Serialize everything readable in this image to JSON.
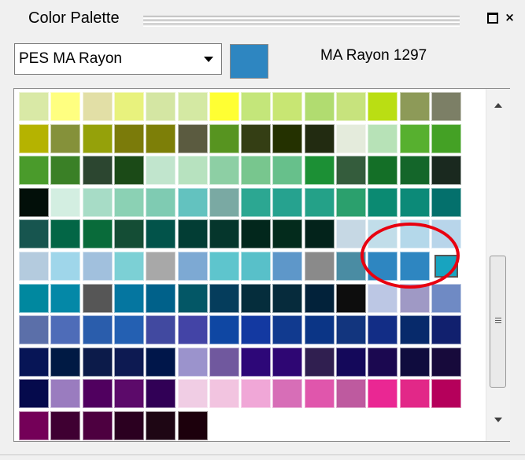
{
  "panel": {
    "title": "Color Palette",
    "restore_icon": "restore-icon",
    "close_icon": "close-icon",
    "close_glyph": "×"
  },
  "thread_selector": {
    "value": "PES MA Rayon",
    "arrow_icon": "dropdown-arrow-icon"
  },
  "current_color": {
    "name": "MA Rayon 1297",
    "hex": "#2e86c1"
  },
  "palette": {
    "columns": 15,
    "selected_index": 83,
    "colors": [
      "#d9e9a6",
      "#ffff80",
      "#e2dfa6",
      "#e8f27d",
      "#d4e6a3",
      "#d4e9a3",
      "#ffff33",
      "#c4e67a",
      "#c8e673",
      "#b1dc70",
      "#c7e37d",
      "#bade13",
      "#8d9a58",
      "#7c7f66",
      "#b5b300",
      "#85913a",
      "#95a10a",
      "#7b7b0a",
      "#7d7f08",
      "#5b5b40",
      "#579420",
      "#343e14",
      "#243100",
      "#222b11",
      "#e4ebdc",
      "#b7e2b7",
      "#57b02f",
      "#44a125",
      "#4a9b2b",
      "#3a8026",
      "#2c4630",
      "#1b4a17",
      "#c1e5cd",
      "#b7e2bf",
      "#8dcfa4",
      "#78c68e",
      "#67c08b",
      "#1c9035",
      "#345c3c",
      "#146f27",
      "#14662a",
      "#1a291f",
      "#020f09",
      "#d3eee1",
      "#a7dcc6",
      "#8bd1b4",
      "#7fcbb2",
      "#63c2bf",
      "#7aa9a3",
      "#2ca792",
      "#26a28f",
      "#24a188",
      "#2ba06d",
      "#0b8a72",
      "#0c8a78",
      "#04706c",
      "#17554f",
      "#036646",
      "#096b3a",
      "#144d35",
      "#02534a",
      "#023d34",
      "#05362c",
      "#02271c",
      "#032b1c",
      "#03231b",
      "#c6d8e4",
      "#c1dde9",
      "#b4d8ea",
      "#b8d5ea",
      "#b4cbde",
      "#9fd6ea",
      "#a1c0dd",
      "#7cd0d5",
      "#a8a8a8",
      "#7da9d3",
      "#5ec5cd",
      "#58c0c9",
      "#5e97c9",
      "#8a8a8a",
      "#4a8ca3",
      "#2e86c1",
      "#2e86c1",
      "#18a4c0",
      "#00889f",
      "#0488a7",
      "#565656",
      "#0576a0",
      "#00618a",
      "#035766",
      "#053d5c",
      "#052d3c",
      "#062b3c",
      "#02223a",
      "#0d0d0d",
      "#bcc7e4",
      "#9f99c5",
      "#6f8ac4",
      "#5b6fa9",
      "#4e6cb8",
      "#2a5dac",
      "#2460b2",
      "#4149a0",
      "#4344a6",
      "#0f47a3",
      "#1339a1",
      "#113a8f",
      "#0b3586",
      "#12357e",
      "#122d86",
      "#072a6b",
      "#11206e",
      "#071556",
      "#001a44",
      "#0c1b4a",
      "#0d1a52",
      "#00164a",
      "#9b93cc",
      "#70589e",
      "#2d0778",
      "#2e0673",
      "#301f50",
      "#14085a",
      "#1b0850",
      "#0f0c3e",
      "#170a3b",
      "#050a4c",
      "#9a7cbf",
      "#50005f",
      "#5c0a6a",
      "#310056",
      "#f0cde4",
      "#f2c4e0",
      "#f0a7d7",
      "#d76eb7",
      "#e056ac",
      "#be5a9f",
      "#ea2793",
      "#e22888",
      "#b5005b",
      "#740058",
      "#3f0032",
      "#4d0040",
      "#2b0020",
      "#1e0614",
      "#1c000c"
    ]
  },
  "scrollbar": {
    "up_icon": "scroll-up-icon",
    "down_icon": "scroll-down-icon",
    "thumb_icon": "scroll-thumb-grip-icon",
    "position_fraction": 0.55
  },
  "annotation": {
    "ring_color": "#e8000f"
  }
}
